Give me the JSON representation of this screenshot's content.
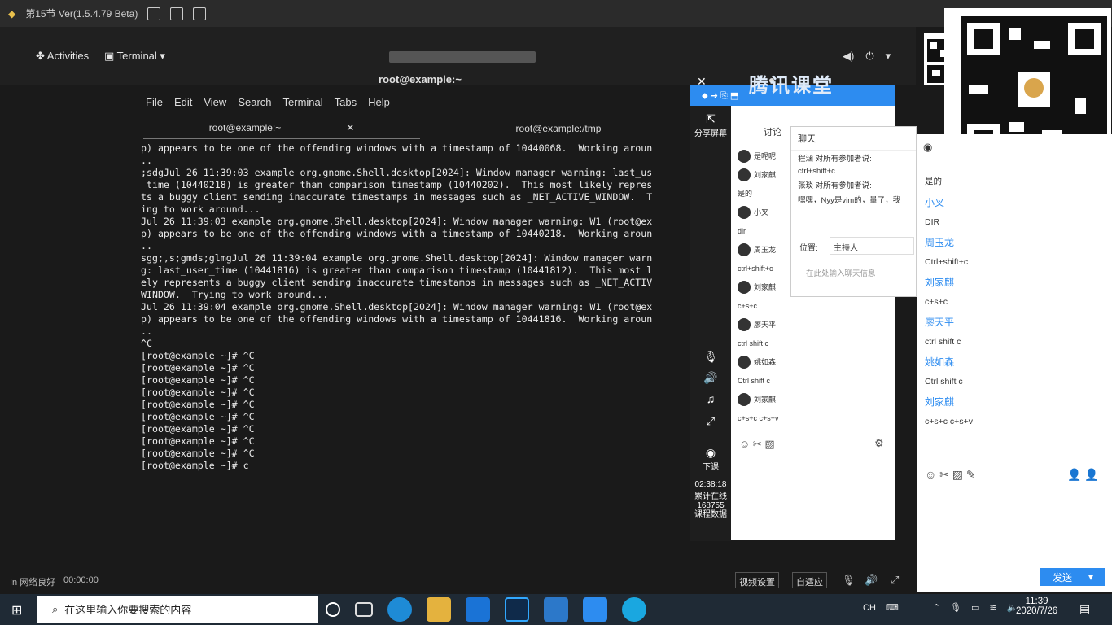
{
  "recorder": {
    "title": "第15节 Ver(1.5.4.79 Beta)"
  },
  "gnome": {
    "activities": "Activities",
    "app_menu": "Terminal ▾",
    "tray": [
      "◀)",
      "⏻",
      "▾"
    ]
  },
  "terminal": {
    "window_title": "root@example:~",
    "menu": [
      "File",
      "Edit",
      "View",
      "Search",
      "Terminal",
      "Tabs",
      "Help"
    ],
    "tabs": [
      {
        "label": "root@example:~",
        "close": "✕"
      },
      {
        "label": "root@example:/tmp",
        "close": ""
      }
    ],
    "output": [
      "p) appears to be one of the offending windows with a timestamp of 10440068.  Working aroun",
      "..",
      ";sdgJul 26 11:39:03 example org.gnome.Shell.desktop[2024]: Window manager warning: last_us",
      "_time (10440218) is greater than comparison timestamp (10440202).  This most likely repres",
      "ts a buggy client sending inaccurate timestamps in messages such as _NET_ACTIVE_WINDOW.  T",
      "ing to work around...",
      "Jul 26 11:39:03 example org.gnome.Shell.desktop[2024]: Window manager warning: W1 (root@ex",
      "p) appears to be one of the offending windows with a timestamp of 10440218.  Working aroun",
      "..",
      "sgg;,s;gmds;glmgJul 26 11:39:04 example org.gnome.Shell.desktop[2024]: Window manager warn",
      "g: last_user_time (10441816) is greater than comparison timestamp (10441812).  This most l",
      "ely represents a buggy client sending inaccurate timestamps in messages such as _NET_ACTIV",
      "WINDOW.  Trying to work around...",
      "Jul 26 11:39:04 example org.gnome.Shell.desktop[2024]: Window manager warning: W1 (root@ex",
      "p) appears to be one of the offending windows with a timestamp of 10441816.  Working aroun",
      "..",
      "^C",
      "[root@example ~]# ^C",
      "[root@example ~]# ^C",
      "[root@example ~]# ^C",
      "[root@example ~]# ^C",
      "[root@example ~]# ^C",
      "[root@example ~]# ^C",
      "[root@example ~]# ^C",
      "[root@example ~]# ^C",
      "[root@example ~]# ^C",
      "[root@example ~]# c"
    ]
  },
  "tencent": {
    "logo": "腾讯课堂",
    "sidebar": {
      "share": "分享屏幕",
      "leave": "下课",
      "timer": "02:38:18",
      "stats": [
        "累计在线",
        "168755",
        "课程数据"
      ]
    },
    "chat_tab": "讨论",
    "messages": [
      {
        "name": "是呢呢",
        "text": ""
      },
      {
        "name": "刘家麒",
        "text": "是的"
      },
      {
        "name": "小叉",
        "text": "dir"
      },
      {
        "name": "周玉龙",
        "text": "ctrl+shift+c"
      },
      {
        "name": "刘家麒",
        "text": "c+s+c"
      },
      {
        "name": "廖天平",
        "text": "ctrl shift c"
      },
      {
        "name": "姚如森",
        "text": "Ctrl shift c"
      },
      {
        "name": "刘家麒",
        "text": "c+s+c  c+s+v"
      }
    ],
    "popup": {
      "title": "聊天",
      "lines": [
        "程涵 对所有参加者说:",
        "ctrl+shift+c",
        "张琰 对所有参加者说:",
        "嘿嘿，Nyy是vim的，量了，我"
      ],
      "position_label": "位置:",
      "position_value": "主持人",
      "placeholder": "在此处输入聊天信息"
    }
  },
  "right_chat": {
    "messages": [
      {
        "name": "",
        "text": "是的"
      },
      {
        "name": "小叉",
        "text": "DIR"
      },
      {
        "name": "周玉龙",
        "text": "Ctrl+shift+c"
      },
      {
        "name": "刘家麒",
        "text": "c+s+c"
      },
      {
        "name": "廖天平",
        "text": "ctrl shift c"
      },
      {
        "name": "姚如森",
        "text": "Ctrl shift c"
      },
      {
        "name": "刘家麒",
        "text": "c+s+c  c+s+v"
      }
    ],
    "send": "发送",
    "send_arrow": "▾"
  },
  "bottom": {
    "status": "In 网络良好",
    "elapsed": "00:00:00",
    "video_settings": "视频设置",
    "adapt": "自适应"
  },
  "taskbar": {
    "search_placeholder": "在这里输入你要搜索的内容",
    "ime": "CH",
    "time": "11:39",
    "date": "2020/7/26"
  },
  "colors": {
    "accent": "#2d8cf0",
    "terminal_bg": "#1a1a1a",
    "taskbar": "#1f2a35"
  }
}
